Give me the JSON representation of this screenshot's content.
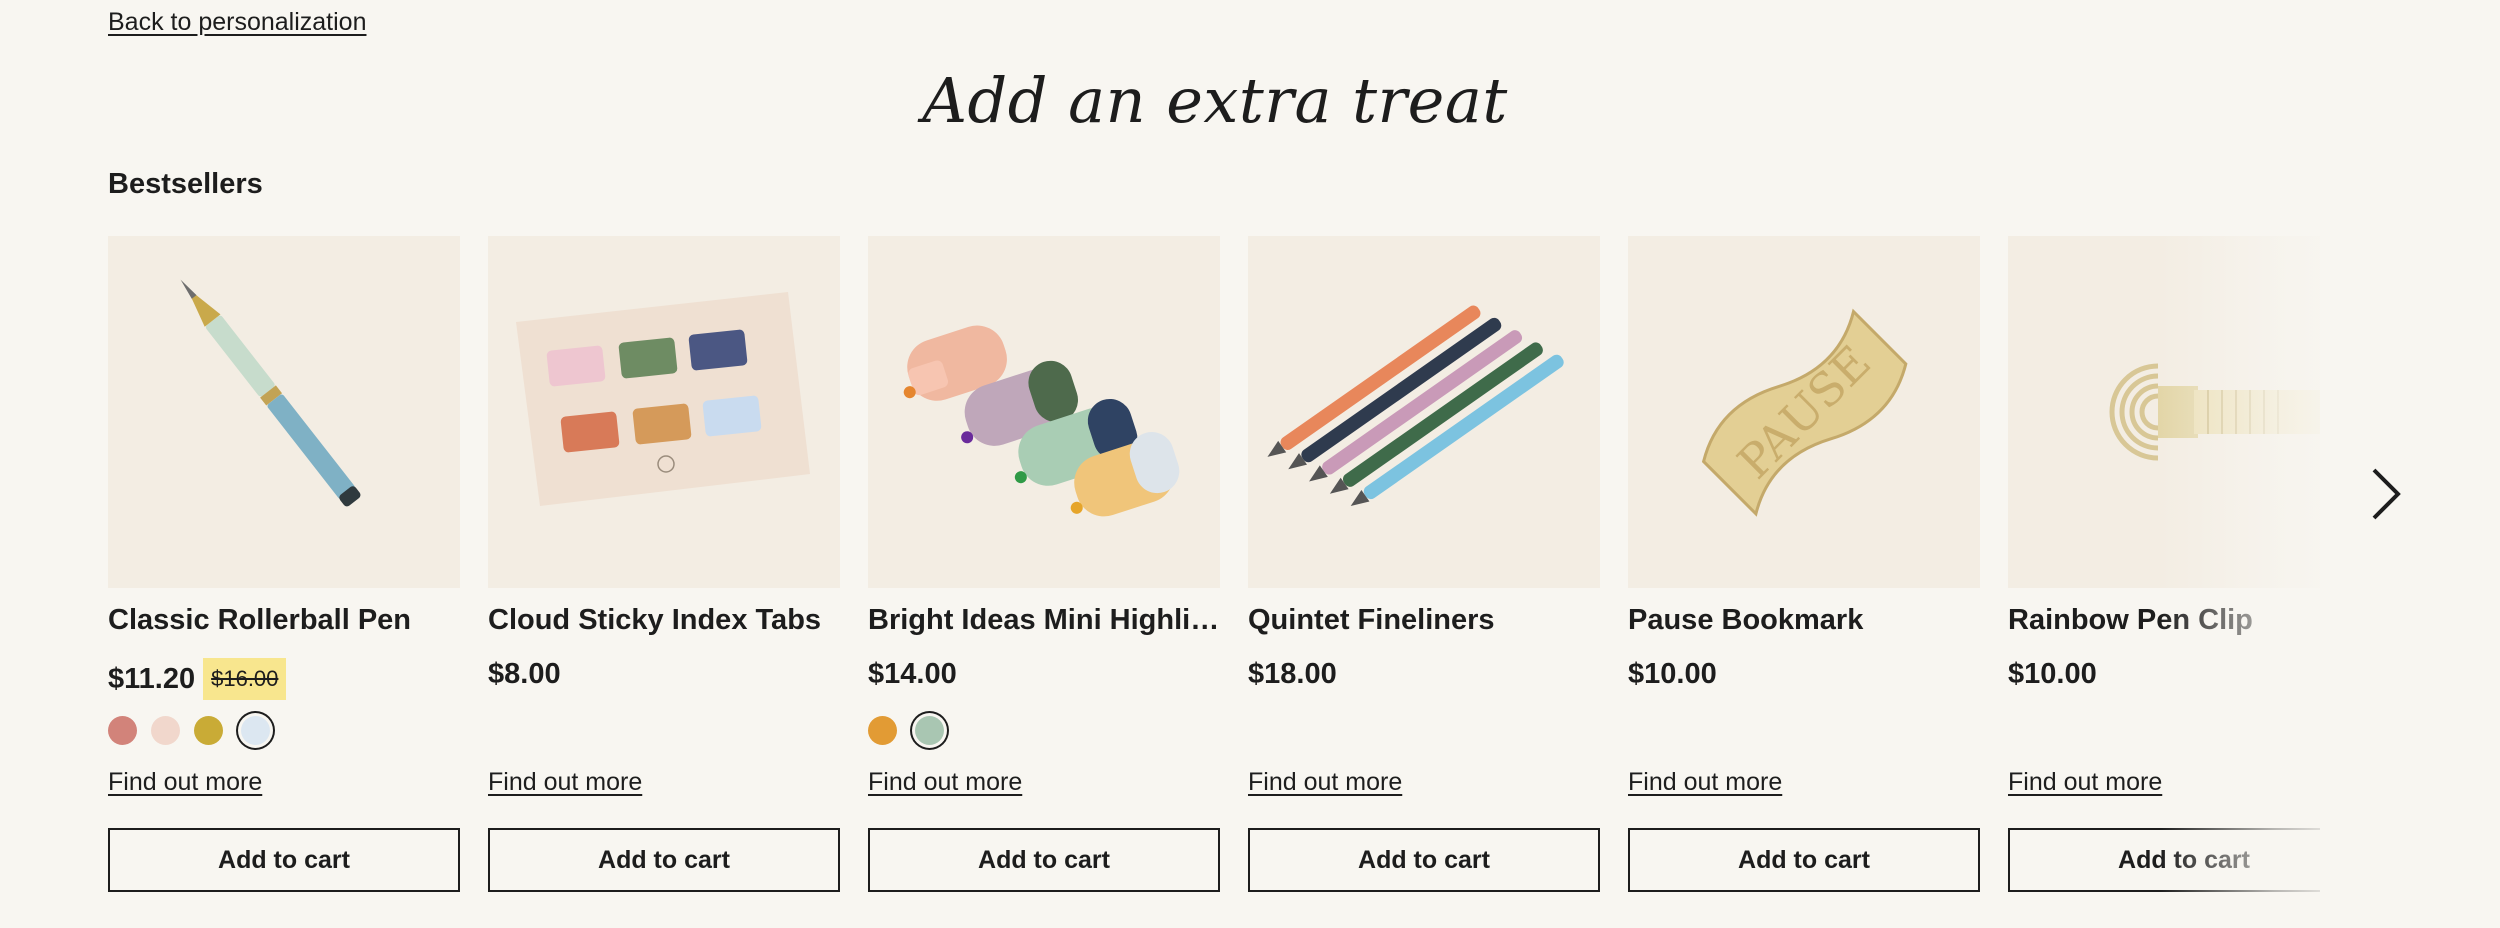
{
  "back_link": "Back to personalization",
  "title": "Add an extra treat",
  "section_heading": "Bestsellers",
  "products": [
    {
      "name": "Classic Rollerball Pen",
      "price": "$11.20",
      "old_price": "$16.00",
      "swatches": [
        "#d2837a",
        "#f1d7cc",
        "#c9ab36",
        "#dce7f1"
      ],
      "selected_swatch": 3,
      "find_more": "Find out more",
      "add_to_cart": "Add to cart"
    },
    {
      "name": "Cloud Sticky Index Tabs",
      "price": "$8.00",
      "find_more": "Find out more",
      "add_to_cart": "Add to cart"
    },
    {
      "name": "Bright Ideas Mini Highlig…",
      "price": "$14.00",
      "swatches": [
        "#e29b34",
        "#a9c6b2"
      ],
      "selected_swatch": 1,
      "find_more": "Find out more",
      "add_to_cart": "Add to cart"
    },
    {
      "name": "Quintet Fineliners",
      "price": "$18.00",
      "find_more": "Find out more",
      "add_to_cart": "Add to cart"
    },
    {
      "name": "Pause Bookmark",
      "price": "$10.00",
      "find_more": "Find out more",
      "add_to_cart": "Add to cart"
    },
    {
      "name": "Rainbow Pen Clip",
      "price": "$10.00",
      "find_more": "Find out more",
      "add_to_cart": "Add to cart"
    }
  ],
  "bookmark_text": "PAUSE",
  "icons": {
    "next": "chevron-right-icon"
  },
  "colors": {
    "background": "#f8f6f1",
    "card_bg": "#f3ede3",
    "sale_highlight": "#f8e68e",
    "text": "#1d1d1d"
  }
}
